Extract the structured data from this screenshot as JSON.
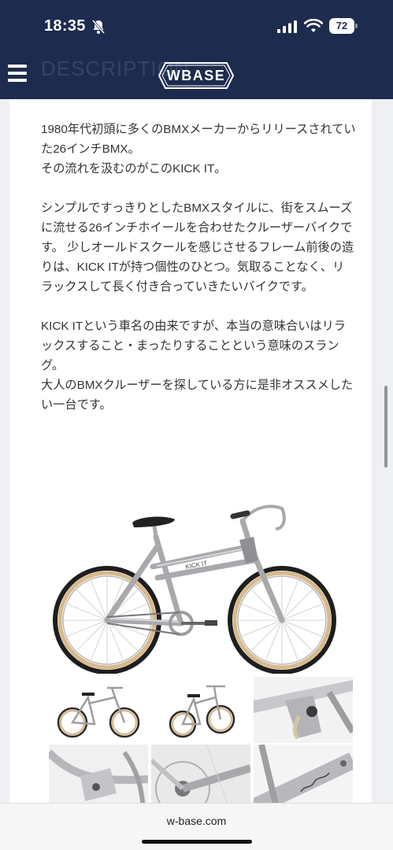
{
  "status": {
    "time": "18:35",
    "battery": "72"
  },
  "header": {
    "ghost_heading": "DESCRIPTION",
    "logo": "WBASE"
  },
  "description": {
    "paragraphs": [
      "1980年代初頭に多くのBMXメーカーからリリースされていた26インチBMX。\nその流れを汲むのがこのKICK IT。",
      "シンプルですっきりとしたBMXスタイルに、街をスムーズに流せる26インチホイールを合わせたクルーザーバイクです。 少しオールドスクールを感じさせるフレーム前後の造りは、KICK ITが持つ個性のひとつ。気取ることなく、リラックスして長く付き合っていきたいバイクです。",
      "KICK ITという車名の由来ですが、本当の意味合いはリラックスすること・まったりすることという意味のスラング。\n大人のBMXクルーザーを探している方に是非オススメしたい一台です。"
    ]
  },
  "gallery": {
    "thumb_count": 6
  },
  "browser": {
    "url": "w-base.com"
  },
  "colors": {
    "header_bg": "#1d2b4e",
    "text": "#333333",
    "tire_wall": "#d8b98a"
  }
}
